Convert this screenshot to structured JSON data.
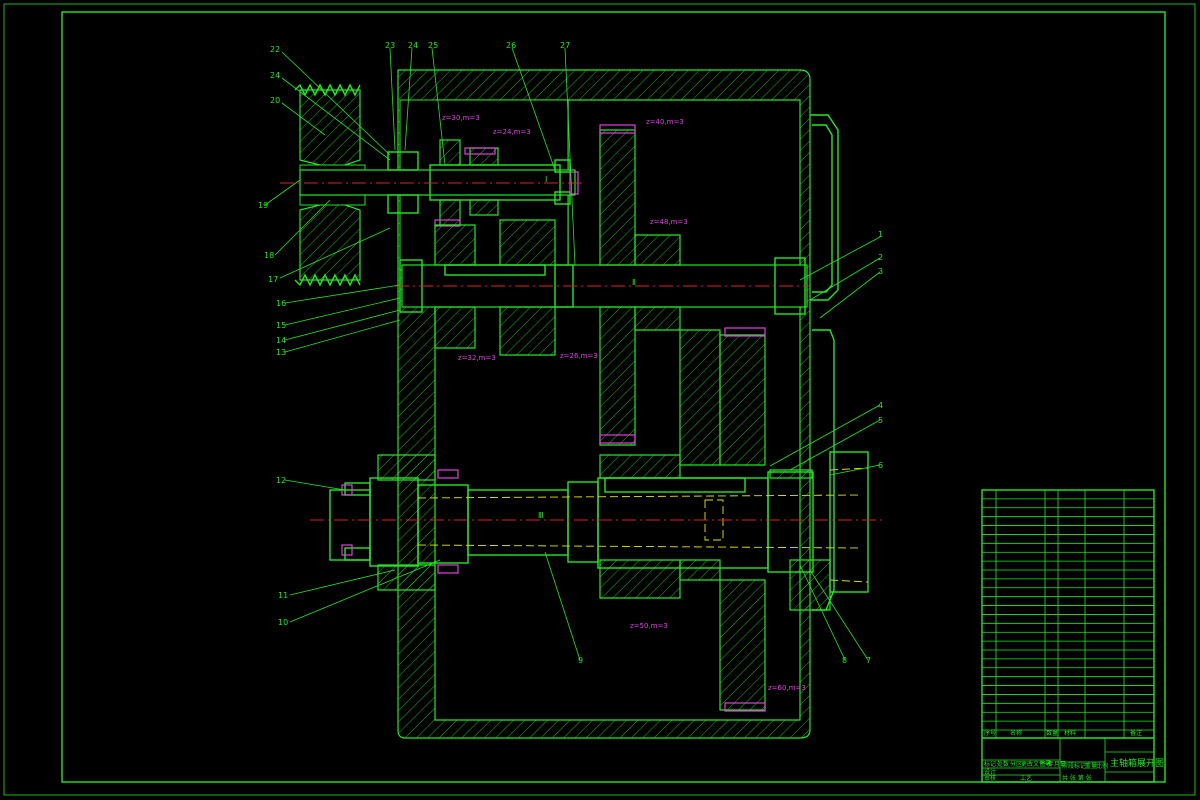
{
  "drawing": {
    "title_block": {
      "drawing_name": "主轴箱展开图",
      "column_headers": [
        "序号",
        "名称",
        "数量",
        "材料",
        "备注"
      ],
      "sign_rows": [
        "标记",
        "处数",
        "分区",
        "更改文件号",
        "签名",
        "年月日"
      ],
      "role_rows": [
        "设计",
        "审核",
        "工艺"
      ],
      "stage_labels": [
        "阶段标记",
        "重量",
        "比例"
      ],
      "sheet_label": "共 张 第 张"
    },
    "part_numbers_left": [
      "22",
      "24",
      "20",
      "19",
      "18",
      "17",
      "16",
      "15",
      "14",
      "13",
      "12",
      "11",
      "10"
    ],
    "part_numbers_top": [
      "23",
      "24",
      "25",
      "26",
      "27"
    ],
    "part_numbers_right": [
      "1",
      "2",
      "3",
      "4",
      "5",
      "6",
      "7",
      "8",
      "9"
    ],
    "shaft_labels": [
      "Ⅰ",
      "Ⅱ",
      "Ⅲ"
    ],
    "gear_annotations": [
      "z=30,m=3",
      "z=24,m=3",
      "z=40,m=3",
      "z=48,m=3",
      "z=32,m=3",
      "z=26,m=3",
      "z=50,m=3",
      "z=60,m=3"
    ],
    "bom_rows": 27,
    "colors": {
      "outline": "#22e822",
      "centerline": "#e02020",
      "hidden": "#e6e600",
      "dimension": "#e040e0",
      "background": "#000000"
    }
  }
}
